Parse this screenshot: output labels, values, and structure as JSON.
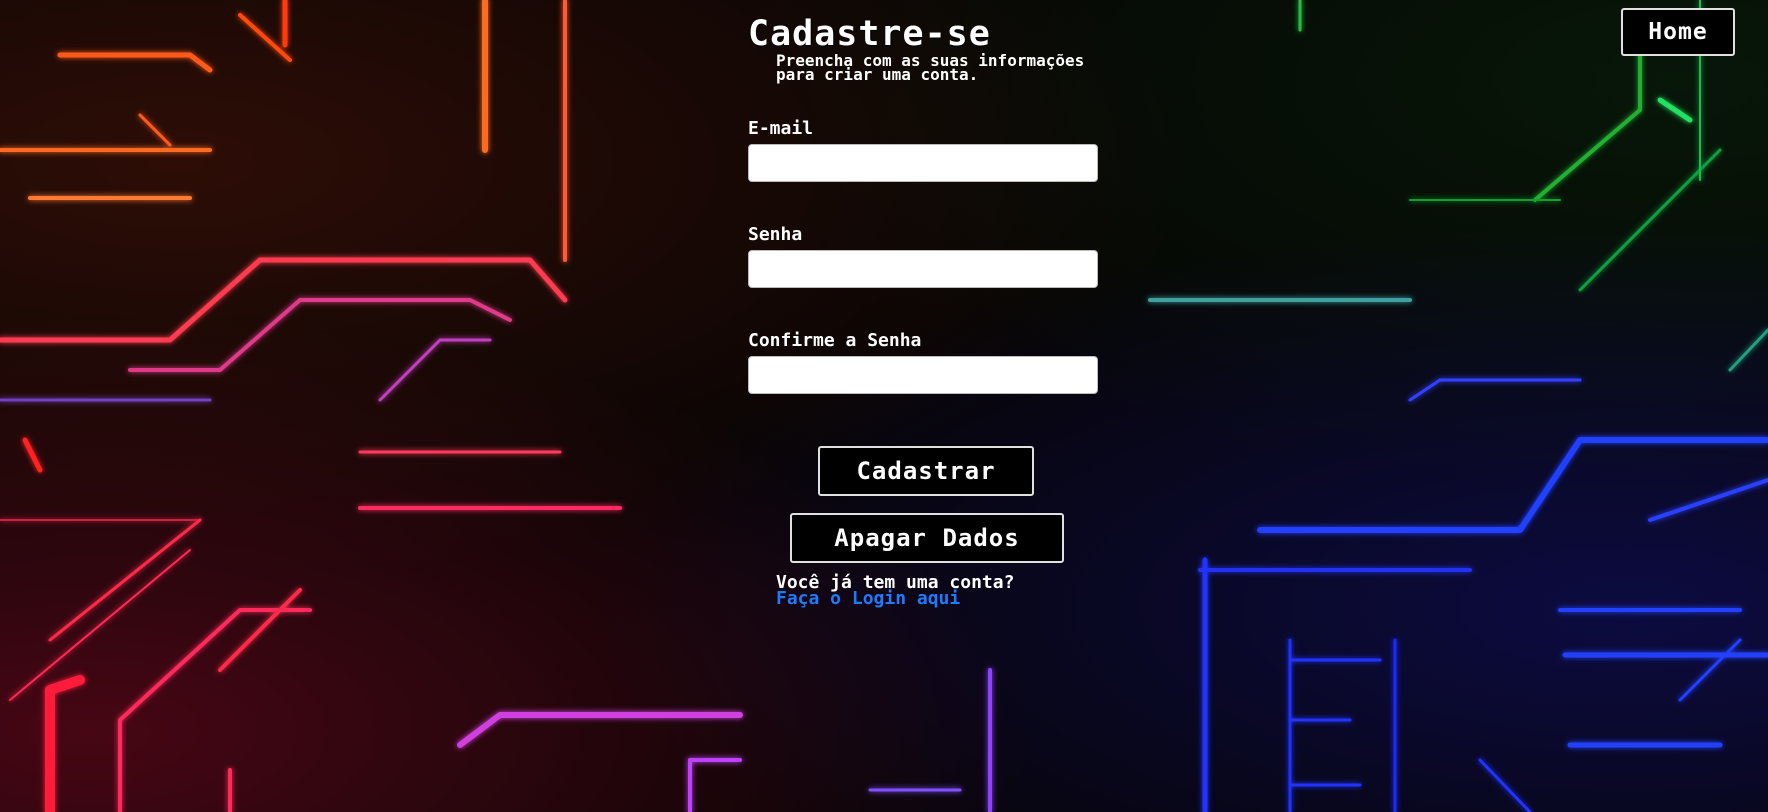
{
  "header": {
    "home_label": "Home"
  },
  "form": {
    "title": "Cadastre-se",
    "subtitle": "Preencha com as suas informações para criar uma conta.",
    "fields": [
      {
        "label": "E-mail",
        "value": "",
        "type": "email"
      },
      {
        "label": "Senha",
        "value": "",
        "type": "password"
      },
      {
        "label": "Confirme a Senha",
        "value": "",
        "type": "password"
      }
    ],
    "submit_label": "Cadastrar",
    "clear_label": "Apagar Dados"
  },
  "account": {
    "question": "Você já tem uma conta?",
    "login_link": "Faça o Login aqui"
  },
  "colors": {
    "background": "#050404",
    "text": "#ffffff",
    "link": "#1e7bff",
    "button_border": "#e0e0e0"
  }
}
